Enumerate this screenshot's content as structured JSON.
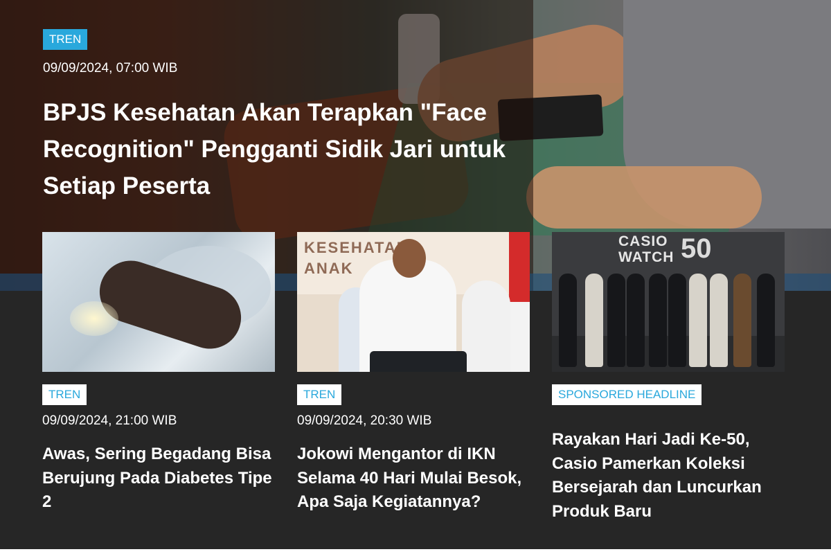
{
  "hero": {
    "tag": "TREN",
    "date": "09/09/2024, 07:00 WIB",
    "title": "BPJS Kesehatan Akan Terapkan \"Face Recognition\" Pengganti Sidik Jari untuk Setiap Peserta"
  },
  "cards": [
    {
      "tag": "TREN",
      "date": "09/09/2024, 21:00 WIB",
      "title": "Awas, Sering Begadang Bisa Berujung Pada Diabetes Tipe 2"
    },
    {
      "tag": "TREN",
      "date": "09/09/2024, 20:30 WIB",
      "title": "Jokowi Mengantor di IKN Selama 40 Hari Mulai Besok, Apa Saja Kegiatannya?",
      "image_text": "KESEHATAN ANAK"
    },
    {
      "tag": "SPONSORED HEADLINE",
      "title": "Rayakan Hari Jadi Ke-50, Casio Pamerkan Koleksi Bersejarah dan Luncurkan Produk Baru",
      "image_logo": "CASIO WATCH",
      "image_badge": "50"
    }
  ],
  "colors": {
    "accent": "#29a8dc",
    "background": "#262626",
    "text": "#ffffff"
  }
}
